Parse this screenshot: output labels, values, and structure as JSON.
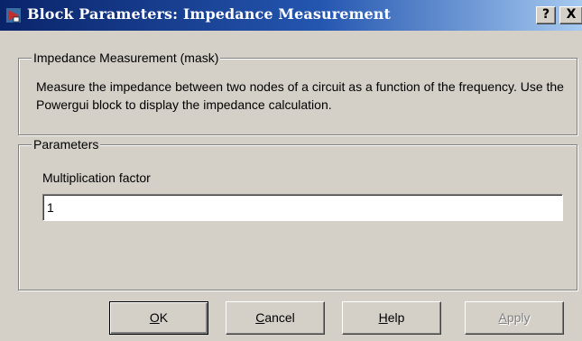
{
  "window": {
    "title": "Block Parameters: Impedance Measurement",
    "help_button": "?",
    "close_button": "X"
  },
  "description_group": {
    "legend": "Impedance Measurement (mask)",
    "text": "Measure the impedance between two nodes of a circuit as a function of the frequency. Use the Powergui block to display the impedance calculation."
  },
  "parameters_group": {
    "legend": "Parameters",
    "fields": [
      {
        "label": "Multiplication factor",
        "value": "1"
      }
    ]
  },
  "buttons": {
    "ok": {
      "mnemonic": "O",
      "rest": "K",
      "enabled": true
    },
    "cancel": {
      "mnemonic": "C",
      "rest": "ancel",
      "enabled": true
    },
    "help": {
      "mnemonic": "H",
      "rest": "elp",
      "enabled": true
    },
    "apply": {
      "mnemonic": "A",
      "rest": "pply",
      "enabled": false
    }
  },
  "colors": {
    "titlebar_start": "#0a246a",
    "titlebar_end": "#a6caf0",
    "face": "#d4d0c8",
    "disabled_text": "#808080"
  }
}
